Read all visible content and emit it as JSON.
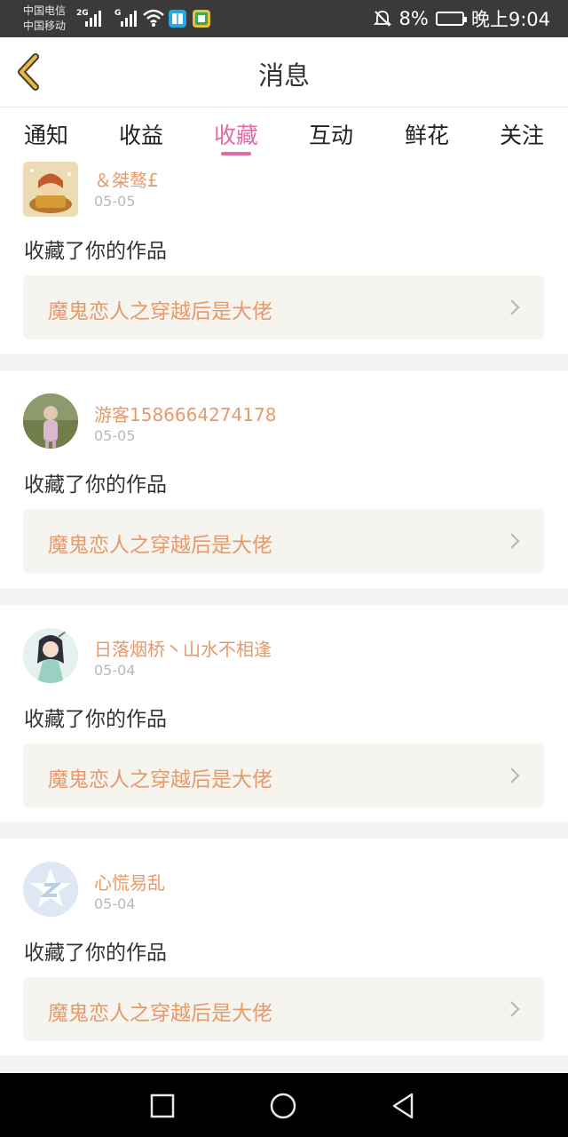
{
  "status_bar": {
    "carrier1": "中国电信",
    "carrier2": "中国移动",
    "net1": "2G",
    "net2": "G",
    "battery": "8%",
    "time": "晚上9:04"
  },
  "header": {
    "title": "消息"
  },
  "tabs": [
    {
      "label": "通知"
    },
    {
      "label": "收益"
    },
    {
      "label": "收藏"
    },
    {
      "label": "互动"
    },
    {
      "label": "鲜花"
    },
    {
      "label": "关注"
    }
  ],
  "active_tab": "收藏",
  "items": [
    {
      "user": "＆桀骜£",
      "date": "05-05",
      "action": "收藏了你的作品",
      "work": "魔鬼恋人之穿越后是大佬"
    },
    {
      "user": "游客1586664274178",
      "date": "05-05",
      "action": "收藏了你的作品",
      "work": "魔鬼恋人之穿越后是大佬"
    },
    {
      "user": "日落烟桥丶山水不相逢",
      "date": "05-04",
      "action": "收藏了你的作品",
      "work": "魔鬼恋人之穿越后是大佬"
    },
    {
      "user": "心慌易乱",
      "date": "05-04",
      "action": "收藏了你的作品",
      "work": "魔鬼恋人之穿越后是大佬"
    }
  ],
  "colors": {
    "accent": "#e46aa4",
    "name": "#e69a6c",
    "back_arrow": "#e8b93a"
  },
  "icons": [
    "back-arrow-icon",
    "chevron-right-icon",
    "recent-apps-icon",
    "home-icon",
    "back-nav-icon",
    "signal-icon",
    "wifi-icon",
    "battery-icon",
    "mute-icon"
  ]
}
